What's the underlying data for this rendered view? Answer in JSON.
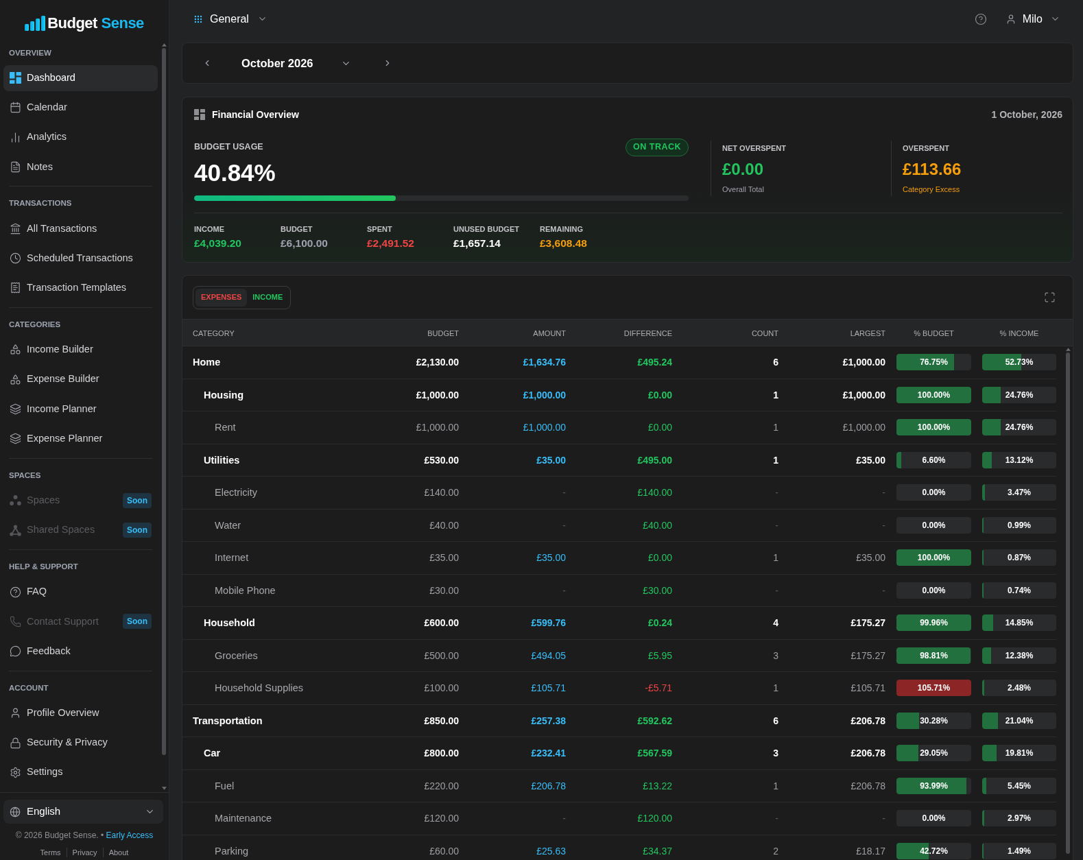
{
  "sidebar": {
    "logo": {
      "name_part_1": "Budget",
      "name_part_2": "Sense"
    },
    "sections": [
      {
        "title": "OVERVIEW",
        "items": [
          {
            "label": "Dashboard",
            "selected": true,
            "disabled": false
          },
          {
            "label": "Calendar",
            "selected": false,
            "disabled": false
          },
          {
            "label": "Analytics",
            "selected": false,
            "disabled": false
          },
          {
            "label": "Notes",
            "selected": false,
            "disabled": false
          }
        ]
      },
      {
        "title": "TRANSACTIONS",
        "items": [
          {
            "label": "All Transactions",
            "selected": false,
            "disabled": false
          },
          {
            "label": "Scheduled Transactions",
            "selected": false,
            "disabled": false
          },
          {
            "label": "Transaction Templates",
            "selected": false,
            "disabled": false
          }
        ]
      },
      {
        "title": "CATEGORIES",
        "items": [
          {
            "label": "Income Builder",
            "selected": false,
            "disabled": false
          },
          {
            "label": "Expense Builder",
            "selected": false,
            "disabled": false
          },
          {
            "label": "Income Planner",
            "selected": false,
            "disabled": false
          },
          {
            "label": "Expense Planner",
            "selected": false,
            "disabled": false
          }
        ]
      },
      {
        "title": "SPACES",
        "items": [
          {
            "label": "Spaces",
            "selected": false,
            "disabled": true,
            "badge": "Soon"
          },
          {
            "label": "Shared Spaces",
            "selected": false,
            "disabled": true,
            "badge": "Soon"
          }
        ]
      },
      {
        "title": "HELP & SUPPORT",
        "items": [
          {
            "label": "FAQ",
            "selected": false,
            "disabled": false
          },
          {
            "label": "Contact Support",
            "selected": false,
            "disabled": true,
            "badge": "Soon"
          },
          {
            "label": "Feedback",
            "selected": false,
            "disabled": false
          }
        ]
      },
      {
        "title": "ACCOUNT",
        "items": [
          {
            "label": "Profile Overview",
            "selected": false,
            "disabled": false
          },
          {
            "label": "Security & Privacy",
            "selected": false,
            "disabled": false
          },
          {
            "label": "Settings",
            "selected": false,
            "disabled": false
          }
        ]
      }
    ],
    "language": "English",
    "footer": {
      "copyright": "© 2026 Budget Sense.",
      "separator": "•",
      "link": "Early Access",
      "links": [
        "Terms",
        "Privacy",
        "About"
      ]
    }
  },
  "header": {
    "workspace": "General",
    "user": "Milo"
  },
  "month_picker": {
    "label": "October 2026"
  },
  "financial_overview": {
    "title": "Financial Overview",
    "date": "1 October, 2026",
    "budget_usage": {
      "label": "BUDGET USAGE",
      "value": "40.84%",
      "status": "ON TRACK",
      "level": 0.4084
    },
    "metrics": [
      {
        "label": "NET OVERSPENT",
        "value": "£0.00",
        "note": "Overall Total",
        "color": "#22c55e",
        "note_highlighted": false
      },
      {
        "label": "OVERSPENT",
        "value": "£113.66",
        "note": "Category Excess",
        "color": "#f59e0b",
        "note_highlighted": true
      }
    ],
    "stats": [
      {
        "label": "INCOME",
        "value": "£4,039.20",
        "color": "#22c55e"
      },
      {
        "label": "BUDGET",
        "value": "£6,100.00",
        "color": "#9ca3af"
      },
      {
        "label": "SPENT",
        "value": "£2,491.52",
        "color": "#ef4444"
      },
      {
        "label": "UNUSED BUDGET",
        "value": "£1,657.14",
        "color": "#ffffff"
      },
      {
        "label": "REMAINING",
        "value": "£3,608.48",
        "color": "#f59e0b"
      }
    ]
  },
  "table": {
    "tabs": [
      {
        "label": "EXPENSES",
        "selected": true,
        "color": "#ef4444"
      },
      {
        "label": "INCOME",
        "selected": false,
        "color": "#22c55e"
      }
    ],
    "columns": [
      "CATEGORY",
      "BUDGET",
      "AMOUNT",
      "DIFFERENCE",
      "COUNT",
      "LARGEST",
      "% BUDGET",
      "% INCOME"
    ],
    "rows": [
      {
        "category": "Home",
        "budget": "£2,130.00",
        "amount": "£1,634.76",
        "difference": "£495.24",
        "count": "6",
        "largest": "£1,000.00",
        "has_transactions": true,
        "over_budget": false,
        "percent_budget": {
          "text": "76.75%",
          "level": 0.7675
        },
        "percent_income": {
          "text": "52.73%",
          "level": 0.5273
        },
        "children": [
          {
            "category": "Housing",
            "budget": "£1,000.00",
            "amount": "£1,000.00",
            "difference": "£0.00",
            "count": "1",
            "largest": "£1,000.00",
            "has_transactions": true,
            "over_budget": false,
            "percent_budget": {
              "text": "100.00%",
              "level": 1
            },
            "percent_income": {
              "text": "24.76%",
              "level": 0.2476
            },
            "children": [
              {
                "category": "Rent",
                "budget": "£1,000.00",
                "amount": "£1,000.00",
                "difference": "£0.00",
                "count": "1",
                "largest": "£1,000.00",
                "has_transactions": true,
                "over_budget": false,
                "percent_budget": {
                  "text": "100.00%",
                  "level": 1
                },
                "percent_income": {
                  "text": "24.76%",
                  "level": 0.2476
                }
              }
            ]
          },
          {
            "category": "Utilities",
            "budget": "£530.00",
            "amount": "£35.00",
            "difference": "£495.00",
            "count": "1",
            "largest": "£35.00",
            "has_transactions": true,
            "over_budget": false,
            "percent_budget": {
              "text": "6.60%",
              "level": 0.066
            },
            "percent_income": {
              "text": "13.12%",
              "level": 0.1312
            },
            "children": [
              {
                "category": "Electricity",
                "budget": "£140.00",
                "amount": "-",
                "difference": "£140.00",
                "count": "-",
                "largest": "-",
                "has_transactions": false,
                "over_budget": false,
                "percent_budget": {
                  "text": "0.00%",
                  "level": 0
                },
                "percent_income": {
                  "text": "3.47%",
                  "level": 0.0347
                }
              },
              {
                "category": "Water",
                "budget": "£40.00",
                "amount": "-",
                "difference": "£40.00",
                "count": "-",
                "largest": "-",
                "has_transactions": false,
                "over_budget": false,
                "percent_budget": {
                  "text": "0.00%",
                  "level": 0
                },
                "percent_income": {
                  "text": "0.99%",
                  "level": 0.0099
                }
              },
              {
                "category": "Internet",
                "budget": "£35.00",
                "amount": "£35.00",
                "difference": "£0.00",
                "count": "1",
                "largest": "£35.00",
                "has_transactions": true,
                "over_budget": false,
                "percent_budget": {
                  "text": "100.00%",
                  "level": 1
                },
                "percent_income": {
                  "text": "0.87%",
                  "level": 0.0087
                }
              },
              {
                "category": "Mobile Phone",
                "budget": "£30.00",
                "amount": "-",
                "difference": "£30.00",
                "count": "-",
                "largest": "-",
                "has_transactions": false,
                "over_budget": false,
                "percent_budget": {
                  "text": "0.00%",
                  "level": 0
                },
                "percent_income": {
                  "text": "0.74%",
                  "level": 0.0074
                }
              }
            ]
          },
          {
            "category": "Household",
            "budget": "£600.00",
            "amount": "£599.76",
            "difference": "£0.24",
            "count": "4",
            "largest": "£175.27",
            "has_transactions": true,
            "over_budget": false,
            "percent_budget": {
              "text": "99.96%",
              "level": 0.9996
            },
            "percent_income": {
              "text": "14.85%",
              "level": 0.1485
            },
            "children": [
              {
                "category": "Groceries",
                "budget": "£500.00",
                "amount": "£494.05",
                "difference": "£5.95",
                "count": "3",
                "largest": "£175.27",
                "has_transactions": true,
                "over_budget": false,
                "percent_budget": {
                  "text": "98.81%",
                  "level": 0.9881
                },
                "percent_income": {
                  "text": "12.38%",
                  "level": 0.1238
                }
              },
              {
                "category": "Household Supplies",
                "budget": "£100.00",
                "amount": "£105.71",
                "difference": "-£5.71",
                "count": "1",
                "largest": "£105.71",
                "has_transactions": true,
                "over_budget": true,
                "percent_budget": {
                  "text": "105.71%",
                  "level": 1
                },
                "percent_income": {
                  "text": "2.48%",
                  "level": 0.0248
                }
              }
            ]
          }
        ]
      },
      {
        "category": "Transportation",
        "budget": "£850.00",
        "amount": "£257.38",
        "difference": "£592.62",
        "count": "6",
        "largest": "£206.78",
        "has_transactions": true,
        "over_budget": false,
        "percent_budget": {
          "text": "30.28%",
          "level": 0.3028
        },
        "percent_income": {
          "text": "21.04%",
          "level": 0.2104
        },
        "children": [
          {
            "category": "Car",
            "budget": "£800.00",
            "amount": "£232.41",
            "difference": "£567.59",
            "count": "3",
            "largest": "£206.78",
            "has_transactions": true,
            "over_budget": false,
            "percent_budget": {
              "text": "29.05%",
              "level": 0.2905
            },
            "percent_income": {
              "text": "19.81%",
              "level": 0.1981
            },
            "children": [
              {
                "category": "Fuel",
                "budget": "£220.00",
                "amount": "£206.78",
                "difference": "£13.22",
                "count": "1",
                "largest": "£206.78",
                "has_transactions": true,
                "over_budget": false,
                "percent_budget": {
                  "text": "93.99%",
                  "level": 0.9399
                },
                "percent_income": {
                  "text": "5.45%",
                  "level": 0.0545
                }
              },
              {
                "category": "Maintenance",
                "budget": "£120.00",
                "amount": "-",
                "difference": "£120.00",
                "count": "-",
                "largest": "-",
                "has_transactions": false,
                "over_budget": false,
                "percent_budget": {
                  "text": "0.00%",
                  "level": 0
                },
                "percent_income": {
                  "text": "2.97%",
                  "level": 0.0297
                }
              },
              {
                "category": "Parking",
                "budget": "£60.00",
                "amount": "£25.63",
                "difference": "£34.37",
                "count": "2",
                "largest": "£18.17",
                "has_transactions": true,
                "over_budget": false,
                "percent_budget": {
                  "text": "42.72%",
                  "level": 0.4272
                },
                "percent_income": {
                  "text": "1.49%",
                  "level": 0.0149
                }
              }
            ]
          }
        ]
      }
    ]
  }
}
